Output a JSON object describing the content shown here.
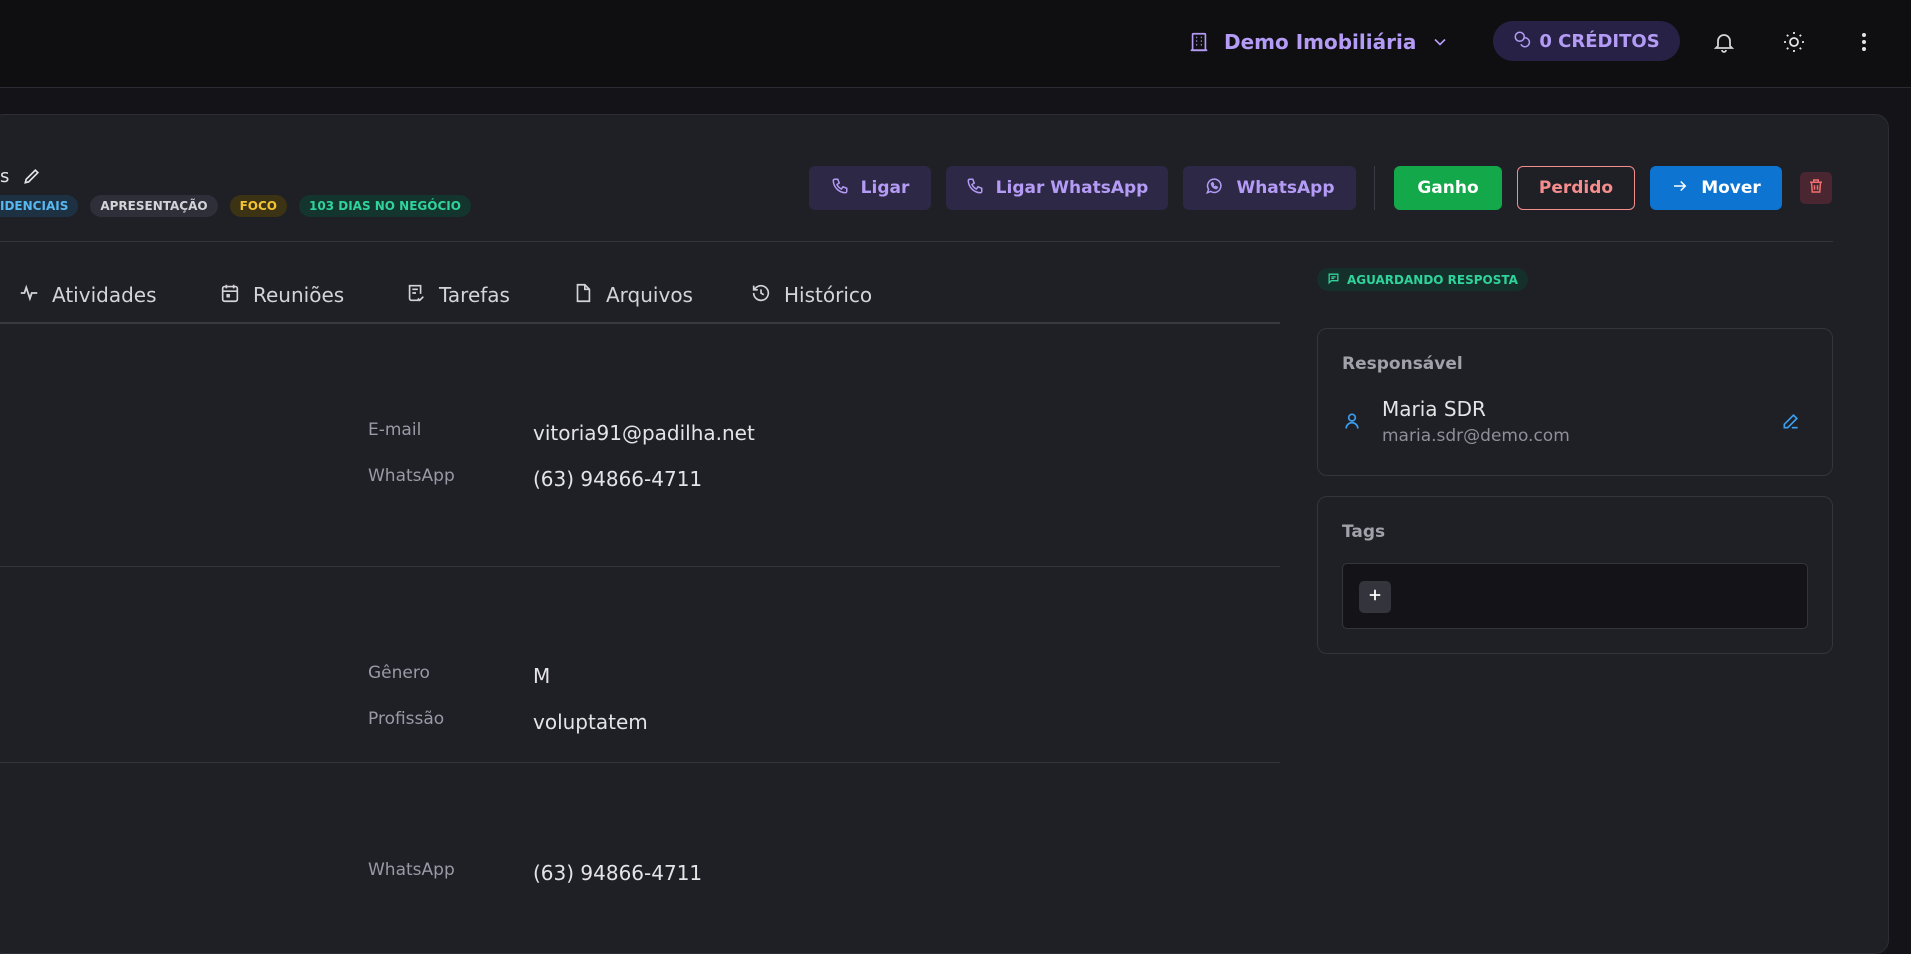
{
  "topbar": {
    "org_name": "Demo Imobiliária",
    "credits_label": "0 CRÉDITOS"
  },
  "deal": {
    "title_fragment": "s",
    "badges": [
      "IDENCIAIS",
      "APRESENTAÇÃO",
      "FOCO",
      "103 DIAS NO NEGÓCIO"
    ]
  },
  "actions": {
    "call": "Ligar",
    "call_whatsapp": "Ligar WhatsApp",
    "whatsapp": "WhatsApp",
    "won": "Ganho",
    "lost": "Perdido",
    "move": "Mover"
  },
  "tabs": [
    "Atividades",
    "Reuniões",
    "Tarefas",
    "Arquivos",
    "Histórico"
  ],
  "contact": {
    "email_label": "E-mail",
    "email_value": "vitoria91@padilha.net",
    "whatsapp_label": "WhatsApp",
    "whatsapp_value": "(63) 94866-4711"
  },
  "profile": {
    "gender_label": "Gênero",
    "gender_value": "M",
    "profession_label": "Profissão",
    "profession_value": "voluptatem"
  },
  "company": {
    "whatsapp_label": "WhatsApp",
    "whatsapp_value": "(63) 94866-4711"
  },
  "sidebar": {
    "status": "AGUARDANDO RESPOSTA",
    "owner_title": "Responsável",
    "owner_name": "Maria SDR",
    "owner_email": "maria.sdr@demo.com",
    "tags_title": "Tags"
  },
  "colors": {
    "accent_purple": "#b49cf6",
    "won_green": "#13a84a",
    "lost_red": "#f58d8d",
    "move_blue": "#0d74d1",
    "status_green": "#2fd39b"
  },
  "icons": [
    "building-icon",
    "chevron-down-icon",
    "coins-icon",
    "bell-icon",
    "sun-icon",
    "more-vertical-icon",
    "pencil-icon",
    "phone-icon",
    "whatsapp-icon",
    "arrow-right-icon",
    "trash-icon",
    "activity-icon",
    "calendar-icon",
    "task-icon",
    "file-icon",
    "history-icon",
    "message-icon",
    "user-icon",
    "edit-icon",
    "plus-icon"
  ]
}
